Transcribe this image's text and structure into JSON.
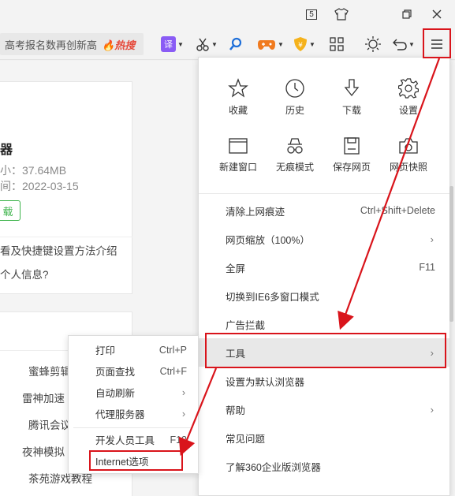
{
  "titlebar": {
    "badge": "5",
    "buttons": [
      "skin-icon",
      "restore-icon",
      "close-icon"
    ]
  },
  "toolbar": {
    "search_text": "高考报名数再创新高",
    "hot_label": "热搜",
    "translate_label": "译",
    "menu_icon": "hamburger-icon"
  },
  "page": {
    "title_fragment": "器",
    "size_text": "小：37.64MB",
    "date_text": "间：2022-03-15",
    "download_btn": "载",
    "line1": "看及快捷键设置方法介绍",
    "line2": "个人信息?",
    "list": [
      "蜜蜂剪辑",
      "雷神加速",
      "腾讯会议",
      "夜神模拟",
      "茶苑游戏教程"
    ]
  },
  "menu": {
    "grid": [
      {
        "label": "收藏",
        "icon": "star-icon"
      },
      {
        "label": "历史",
        "icon": "clock-icon"
      },
      {
        "label": "下载",
        "icon": "download-icon"
      },
      {
        "label": "设置",
        "icon": "gear-icon"
      },
      {
        "label": "新建窗口",
        "icon": "window-icon"
      },
      {
        "label": "无痕模式",
        "icon": "incognito-icon"
      },
      {
        "label": "保存网页",
        "icon": "save-icon"
      },
      {
        "label": "网页快照",
        "icon": "camera-icon"
      }
    ],
    "items": [
      {
        "label": "清除上网痕迹",
        "shortcut": "Ctrl+Shift+Delete"
      },
      {
        "label": "网页缩放（100%）",
        "arrow": "›"
      },
      {
        "label": "全屏",
        "shortcut": "F11"
      },
      {
        "label": "切换到IE6多窗口模式"
      },
      {
        "label": "广告拦截"
      },
      {
        "label": "工具",
        "arrow": "›"
      },
      {
        "label": "设置为默认浏览器"
      },
      {
        "label": "帮助",
        "arrow": "›"
      },
      {
        "label": "常见问题"
      },
      {
        "label": "了解360企业版浏览器"
      }
    ]
  },
  "submenu": {
    "items": [
      {
        "label": "打印",
        "shortcut": "Ctrl+P"
      },
      {
        "label": "页面查找",
        "shortcut": "Ctrl+F"
      },
      {
        "label": "自动刷新",
        "arrow": "›"
      },
      {
        "label": "代理服务器",
        "arrow": "›"
      },
      {
        "label": "开发人员工具",
        "shortcut": "F12"
      },
      {
        "label": "Internet选项"
      }
    ]
  },
  "colors": {
    "highlight_box": "#d9141b",
    "hot": "#e64a3b",
    "download_green": "#3cb34a"
  }
}
